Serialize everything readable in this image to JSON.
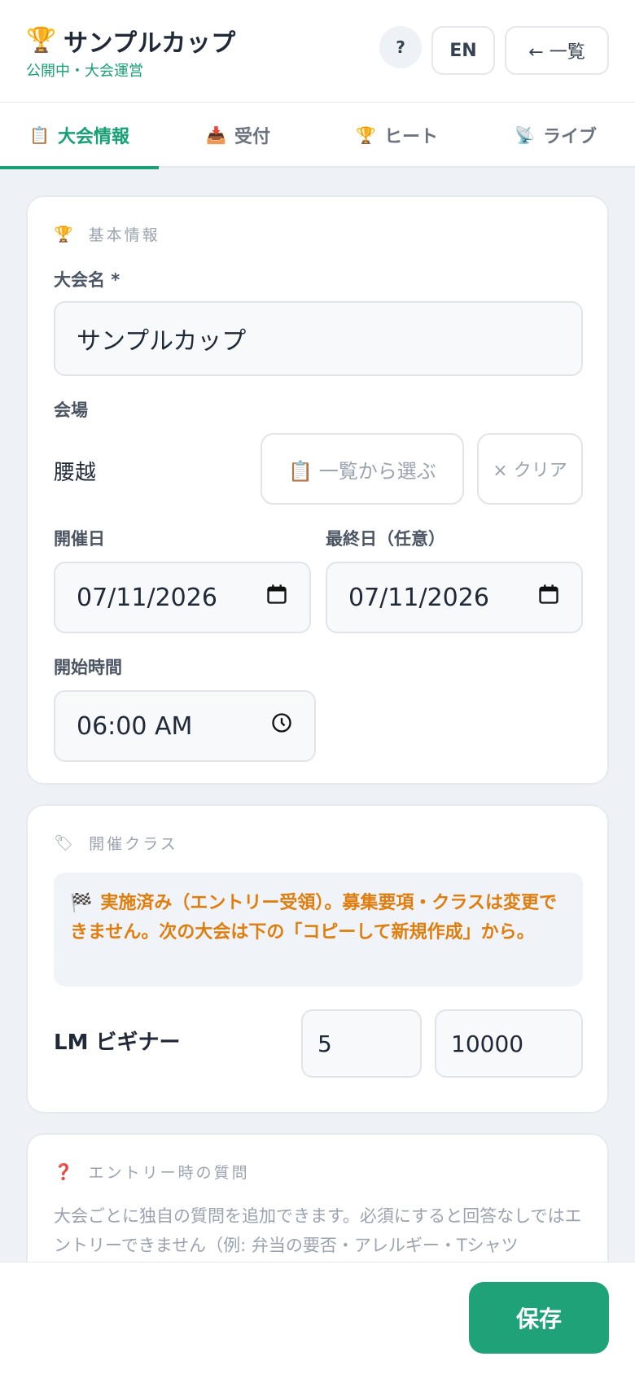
{
  "header": {
    "trophy": "🏆",
    "title": "サンプルカップ",
    "subtitle": "公開中・大会運営",
    "help_label": "?",
    "lang_label": "EN",
    "back_label": "← 一覧"
  },
  "tabs": [
    {
      "icon": "📋",
      "label": "大会情報",
      "active": true
    },
    {
      "icon": "📥",
      "label": "受付",
      "active": false
    },
    {
      "icon": "🏆",
      "label": "ヒート",
      "active": false
    },
    {
      "icon": "📡",
      "label": "ライブ",
      "active": false
    }
  ],
  "basic": {
    "section_icon": "🏆",
    "section_title": "基本情報",
    "name_label": "大会名 *",
    "name_value": "サンプルカップ",
    "venue_label": "会場",
    "venue_value": "腰越",
    "choose_button": "📋 一覧から選ぶ",
    "clear_button": "× クリア",
    "start_date_label": "開催日",
    "start_date_value": "07/11/2026",
    "end_date_label": "最終日（任意）",
    "end_date_value": "07/11/2026",
    "start_time_label": "開始時間",
    "start_time_value": "06:00 AM"
  },
  "classes": {
    "section_icon": "🏷",
    "section_title": "開催クラス",
    "notice_flag": "🏁",
    "notice_text": "実施済み（エントリー受領）。募集要項・クラスは変更できません。次の大会は下の「コピーして新規作成」から。",
    "class_name": "LM ビギナー",
    "class_qty": "5",
    "class_fee": "10000"
  },
  "questions": {
    "section_icon": "❓",
    "section_title": "エントリー時の質問",
    "description": "大会ごとに独自の質問を追加できます。必須にすると回答なしではエントリーできません（例: 弁当の要否・アレルギー・Tシャツ"
  },
  "footer": {
    "save_label": "保存"
  },
  "colors": {
    "accent": "#16a073",
    "warning": "#e07d0c",
    "save_button": "#1fa277"
  }
}
